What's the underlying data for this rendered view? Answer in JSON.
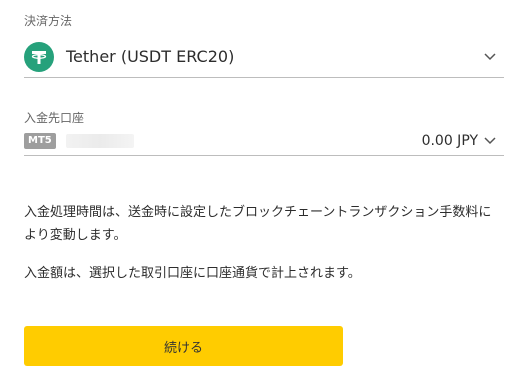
{
  "payment": {
    "label": "決済方法",
    "value": "Tether (USDT ERC20)",
    "icon": "tether-icon",
    "icon_color": "#26a17b"
  },
  "account": {
    "label": "入金先口座",
    "badge": "MT5",
    "balance": "0.00 JPY"
  },
  "info": {
    "processing_time": "入金処理時間は、送金時に設定したブロックチェーントランザクション手数料により変動します。",
    "credit_note": "入金額は、選択した取引口座に口座通貨で計上されます。"
  },
  "actions": {
    "continue_label": "続ける",
    "continue_color": "#ffcc00"
  }
}
